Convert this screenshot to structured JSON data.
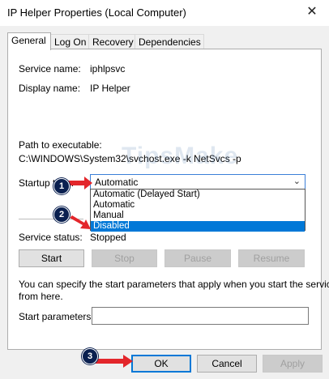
{
  "window": {
    "title": "IP Helper Properties (Local Computer)",
    "close_glyph": "✕"
  },
  "tabs": [
    "General",
    "Log On",
    "Recovery",
    "Dependencies"
  ],
  "general": {
    "service_name_label": "Service name:",
    "service_name_value": "iphlpsvc",
    "display_name_label": "Display name:",
    "display_name_value": "IP Helper",
    "path_label": "Path to executable:",
    "path_value": "C:\\WINDOWS\\System32\\svchost.exe -k NetSvcs -p",
    "startup_type_label": "Startup type:",
    "startup_type_value": "Automatic",
    "startup_options": [
      "Automatic (Delayed Start)",
      "Automatic",
      "Manual",
      "Disabled"
    ],
    "startup_highlighted": "Disabled",
    "service_status_label": "Service status:",
    "service_status_value": "Stopped",
    "buttons": {
      "start": "Start",
      "stop": "Stop",
      "pause": "Pause",
      "resume": "Resume"
    },
    "hint_text_line1": "You can specify the start parameters that apply when you start the service",
    "hint_text_line2": "from here.",
    "start_params_label": "Start parameters:",
    "start_params_value": ""
  },
  "footer": {
    "ok": "OK",
    "cancel": "Cancel",
    "apply": "Apply"
  },
  "annotations": {
    "step1": "1",
    "step2": "2",
    "step3": "3"
  },
  "watermark": "TipsMake",
  "colors": {
    "accent": "#0078d7",
    "arrow": "#e3262b",
    "badge": "#0a2050"
  }
}
